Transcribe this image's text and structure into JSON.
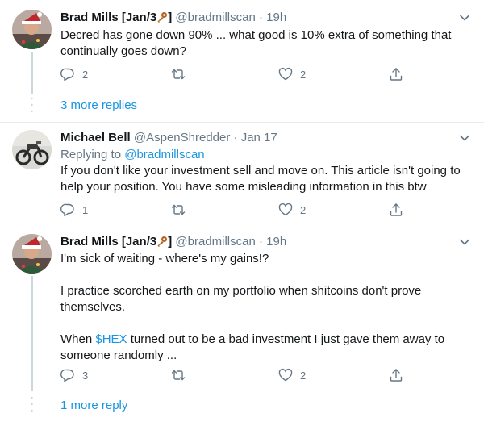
{
  "tweets": [
    {
      "name": "Brad Mills [Jan/3",
      "name_end": "]",
      "handle": "@bradmillscan",
      "dot": "·",
      "time": "19h",
      "text": "Decred has gone down 90% ... what good is 10% extra of something that continually goes down?",
      "replies": "2",
      "retweets": "",
      "likes": "2"
    },
    {
      "name": "Michael Bell",
      "handle": "@AspenShredder",
      "dot": "·",
      "time": "Jan 17",
      "replying_prefix": "Replying to ",
      "replying_to": "@bradmillscan",
      "text": "If you don't like your investment sell and move on. This article isn't going to help your position. You have some misleading information in this btw",
      "replies": "1",
      "retweets": "",
      "likes": "2"
    },
    {
      "name": "Brad Mills [Jan/3",
      "name_end": "]",
      "handle": "@bradmillscan",
      "dot": "·",
      "time": "19h",
      "text_1": "I'm sick of waiting - where's my gains!?",
      "text_2": "I practice scorched earth on my portfolio when shitcoins don't prove themselves.",
      "text_3_prefix": "When ",
      "text_3_cashtag": "$HEX",
      "text_3_suffix": " turned out to be a bad investment I just gave them away to someone randomly ...",
      "replies": "3",
      "retweets": "",
      "likes": "2"
    }
  ],
  "more_replies_1": "3 more replies",
  "more_replies_2": "1 more reply",
  "colors": {
    "text": "#14171a",
    "secondary": "#657786",
    "link": "#1b95e0",
    "divider": "#e6ecf0",
    "thread_line": "#ccd6dd"
  },
  "icons": [
    "reply-icon",
    "retweet-icon",
    "like-icon",
    "share-icon",
    "chevron-down-icon",
    "key-icon"
  ]
}
